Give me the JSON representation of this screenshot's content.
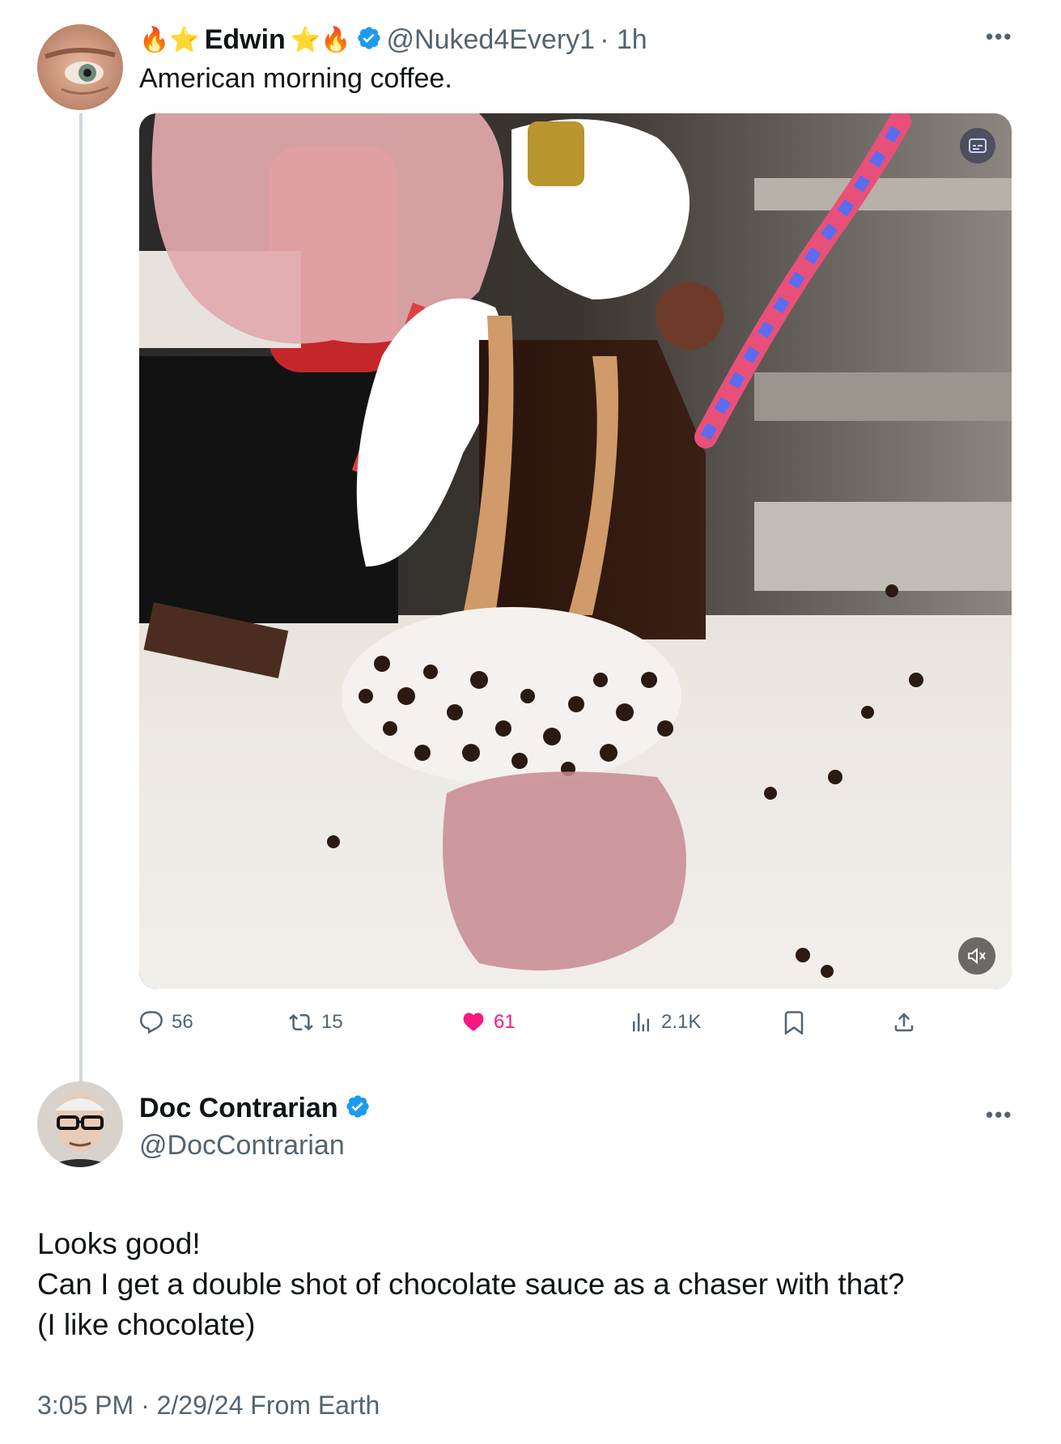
{
  "tweet": {
    "display_name": "Edwin",
    "name_emoji_left": "🔥⭐",
    "name_emoji_right": "⭐🔥",
    "handle": "@Nuked4Every1",
    "time": "· 1h",
    "text": "American morning coffee.",
    "media": {
      "description": "video",
      "mute_icon": "volume-mute-icon",
      "gif_icon": "captions-icon"
    },
    "stats": {
      "replies": "56",
      "reposts": "15",
      "likes": "61",
      "views": "2.1K"
    }
  },
  "reply": {
    "display_name": "Doc Contrarian",
    "handle": "@DocContrarian",
    "lines": [
      "Looks good!",
      "Can I get a double shot of chocolate sauce as a chaser with that?",
      "(I like chocolate)"
    ],
    "timestamp": "3:05 PM · 2/29/24 From Earth"
  },
  "colors": {
    "verified": "#1d9bf0",
    "like": "#f91880",
    "secondary": "#536471"
  }
}
